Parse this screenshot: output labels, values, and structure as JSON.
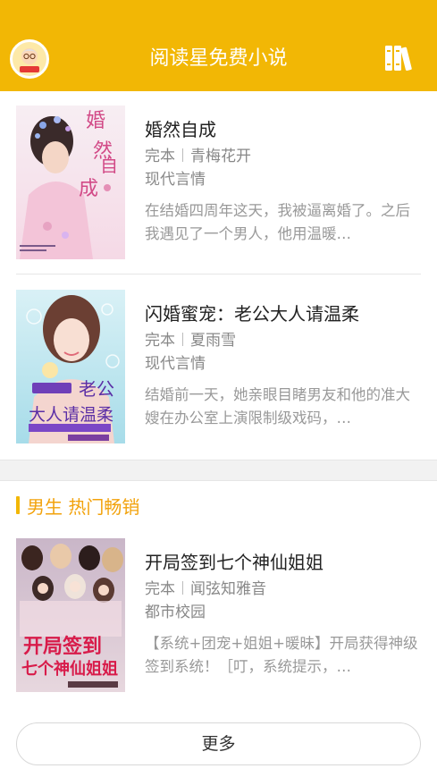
{
  "header": {
    "title": "阅读星免费小说",
    "avatar_icon": "avatar-logo-icon",
    "shelf_icon": "bookshelf-icon",
    "bg_color": "#f2b705"
  },
  "books": [
    {
      "title": "婚然自成",
      "status": "完本",
      "author": "青梅花开",
      "category": "现代言情",
      "description": "在结婚四周年这天，我被逼离婚了。之后我遇见了一个男人，他用温暖…",
      "cover_title": "婚然自成"
    },
    {
      "title": "闪婚蜜宠：老公大人请温柔",
      "status": "完本",
      "author": "夏雨雪",
      "category": "现代言情",
      "description": "结婚前一天，她亲眼目睹男友和他的准大嫂在办公室上演限制级戏码，…",
      "cover_title": "老公大人请温柔"
    }
  ],
  "section": {
    "title": "男生 热门畅销",
    "accent": "#f2b705"
  },
  "male_books": [
    {
      "title": "开局签到七个神仙姐姐",
      "status": "完本",
      "author": "闻弦知雅音",
      "category": "都市校园",
      "description": "【系统+团宠+姐姐+暖昧】开局获得神级签到系统！［叮，系统提示，…",
      "cover_title": "开局签到七个神仙姐姐"
    }
  ],
  "more_button": "更多"
}
